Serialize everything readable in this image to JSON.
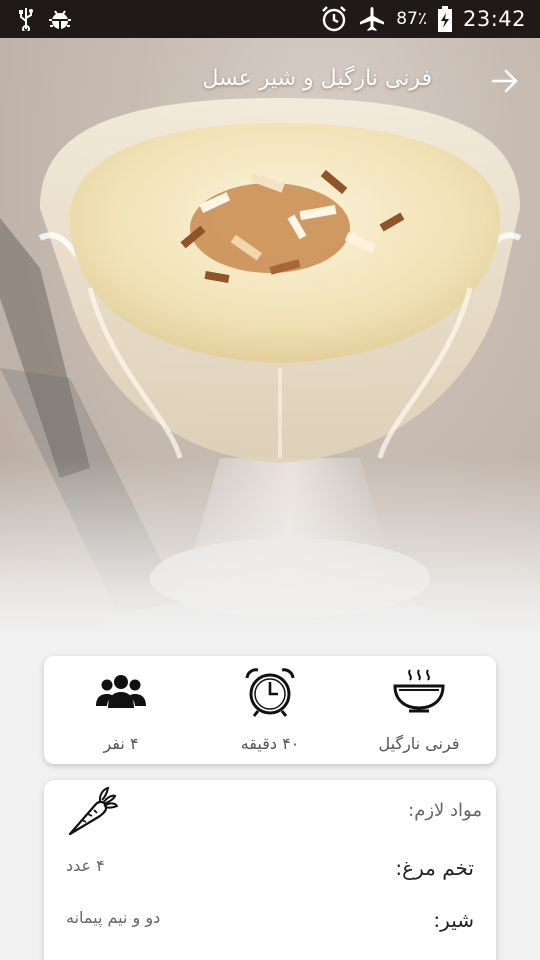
{
  "status_bar": {
    "battery_percent": "87٪",
    "time": "23:42",
    "icons": [
      "usb-icon",
      "android-debug-icon",
      "alarm-icon",
      "airplane-mode-icon",
      "battery-charging-icon"
    ]
  },
  "header": {
    "title": "فرنی نارگیل و شیر عسل",
    "back_icon": "arrow-right-icon"
  },
  "recipe_info": {
    "dish": {
      "label": "فرنی نارگیل",
      "icon": "bowl-steam-icon"
    },
    "duration": {
      "label": "۴۰ دقیقه",
      "icon": "alarm-clock-icon"
    },
    "servings": {
      "label": "۴ نفر",
      "icon": "people-group-icon"
    }
  },
  "ingredients": {
    "heading": "مواد لازم:",
    "icon": "carrot-icon",
    "items": [
      {
        "name": "تخم مرغ:",
        "amount": "۴ عدد"
      },
      {
        "name": "شیر:",
        "amount": "دو و نیم پیمانه"
      }
    ]
  },
  "colors": {
    "status_bar_bg": "#1f1a17",
    "page_bg": "#f1f1f1",
    "card_bg": "#ffffff"
  }
}
